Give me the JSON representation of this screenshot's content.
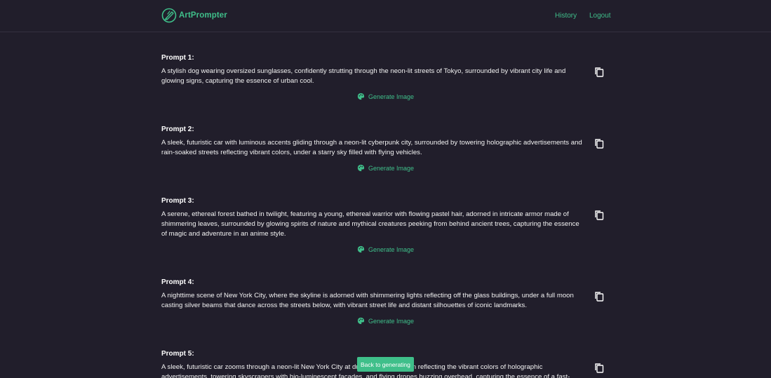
{
  "header": {
    "brand": "ArtPrompter",
    "nav": {
      "history": "History",
      "logout": "Logout"
    }
  },
  "prompts": [
    {
      "title": "Prompt 1:",
      "text": "A stylish dog wearing oversized sunglasses, confidently strutting through the neon-lit streets of Tokyo, surrounded by vibrant city life and glowing signs, capturing the essence of urban cool.",
      "action": "Generate Image"
    },
    {
      "title": "Prompt 2:",
      "text": "A sleek, futuristic car with luminous accents gliding through a neon-lit cyberpunk city, surrounded by towering holographic advertisements and rain-soaked streets reflecting vibrant colors, under a starry sky filled with flying vehicles.",
      "action": "Generate Image"
    },
    {
      "title": "Prompt 3:",
      "text": "A serene, ethereal forest bathed in twilight, featuring a young, ethereal warrior with flowing pastel hair, adorned in intricate armor made of shimmering leaves, surrounded by glowing spirits of nature and mythical creatures peeking from behind ancient trees, capturing the essence of magic and adventure in an anime style.",
      "action": "Generate Image"
    },
    {
      "title": "Prompt 4:",
      "text": "A nighttime scene of New York City, where the skyline is adorned with shimmering lights reflecting off the glass buildings, under a full moon casting silver beams that dance across the streets below, with vibrant street life and distant silhouettes of iconic landmarks.",
      "action": "Generate Image"
    },
    {
      "title": "Prompt 5:",
      "text": "A sleek, futuristic car zooms through a neon-lit New York City at dusk, its sleek design reflecting the vibrant colors of holographic advertisements, towering skyscrapers with bio-luminescent facades, and flying drones buzzing overhead, capturing the essence of a fast-paced,",
      "action": ""
    }
  ],
  "floating_button": "Back to generating",
  "colors": {
    "background": "#211e2b",
    "accent": "#3fbf8a",
    "text": "#ffffff"
  },
  "icons": {
    "logo": "brush-logo-icon",
    "copy": "copy-icon",
    "palette": "palette-icon"
  }
}
